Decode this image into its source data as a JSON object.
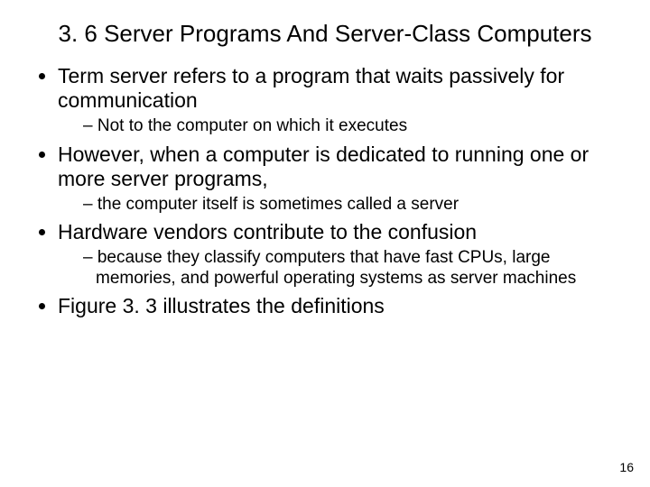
{
  "title": "3. 6  Server Programs And Server-Class Computers",
  "bullets": [
    {
      "text": "Term server refers to a program that waits passively for communication",
      "sub": [
        "Not to the computer on which it executes"
      ]
    },
    {
      "text": "However, when a computer is dedicated to running one or more server programs,",
      "sub": [
        "the computer itself is sometimes called a server"
      ]
    },
    {
      "text": "Hardware vendors contribute to the confusion",
      "sub": [
        "because they classify computers that have fast CPUs, large memories, and powerful operating systems as  server  machines"
      ]
    },
    {
      "text": "Figure 3. 3 illustrates the definitions",
      "sub": []
    }
  ],
  "page_number": "16"
}
